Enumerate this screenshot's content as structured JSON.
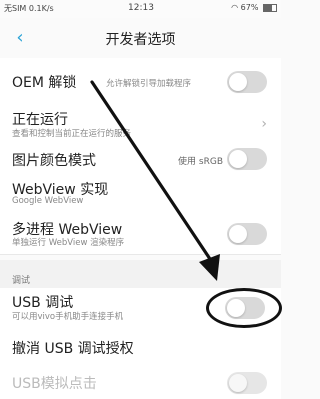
{
  "status_bar": {
    "left": "无SIM 0.1K/s",
    "time": "12:13",
    "battery": "67%",
    "battery_level": 0.67
  },
  "header": {
    "title": "开发者选项"
  },
  "rows": {
    "oem_unlock": {
      "title": "OEM 解锁",
      "subtitle": "允许解锁引导加载程序"
    },
    "running": {
      "title": "正在运行",
      "subtitle": "查看和控制当前正在运行的服务"
    },
    "picture_color": {
      "title": "图片颜色模式",
      "value": "使用 sRGB"
    },
    "webview_impl": {
      "title": "WebView 实现",
      "subtitle": "Google WebView"
    },
    "multiprocess_webview": {
      "title": "多进程 WebView",
      "subtitle": "单独运行 WebView 渲染程序"
    },
    "usb_debug": {
      "title": "USB 调试",
      "subtitle": "可以用vivo手机助手连接手机"
    },
    "revoke_usb": {
      "title": "撤消 USB 调试授权"
    },
    "usb_sim_tap": {
      "title": "USB模拟点击"
    }
  },
  "section_debug": {
    "label": "调试"
  }
}
